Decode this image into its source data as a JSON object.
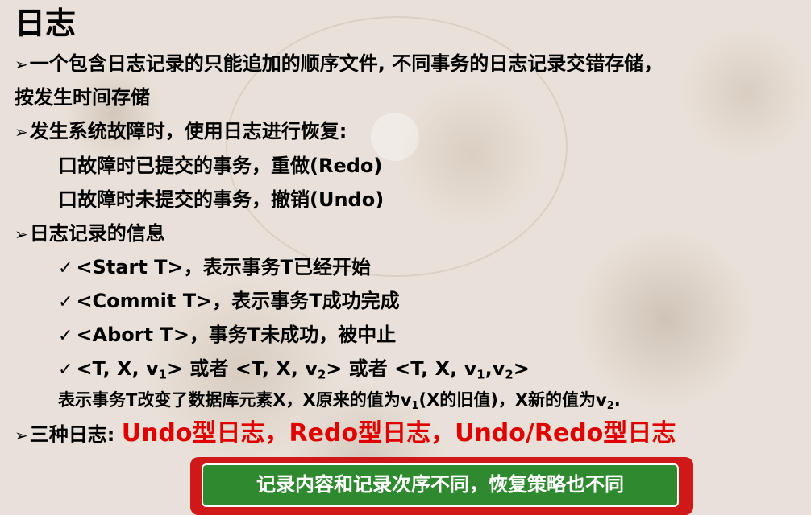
{
  "title": "日志",
  "bullet_arrow": "➢",
  "check_mark": "✓",
  "box_mark": "口",
  "point1": {
    "line1": "一个包含日志记录的只能追加的顺序文件, 不同事务的日志记录交错存储，",
    "line2": "按发生时间存储"
  },
  "point2": {
    "text": "发生系统故障时，使用日志进行恢复:",
    "sub1": "故障时已提交的事务，重做(Redo)",
    "sub2": "故障时未提交的事务，撤销(Undo)"
  },
  "point3": {
    "text": "日志记录的信息",
    "items": [
      "<Start T>，表示事务T已经开始",
      "<Commit T>，表示事务T成功完成",
      "<Abort T>，事务T未成功，被中止"
    ],
    "item4": {
      "p1": "<T, X, v",
      "s1": "1",
      "p2": "> 或者 <T, X, v",
      "s2": "2",
      "p3": "> 或者 <T, X, v",
      "s3": "1",
      "p4": ",v",
      "s4": "2",
      "p5": ">"
    },
    "desc": {
      "p1": "表示事务T改变了数据库元素X，X原来的值为v",
      "s1": "1",
      "p2": "(X的旧值)，X新的值为v",
      "s2": "2",
      "p3": "."
    }
  },
  "point4": {
    "label": "三种日志: ",
    "types": [
      "Undo型日志",
      "Redo型日志",
      "Undo/Redo型日志"
    ],
    "separator": "，"
  },
  "banner": "记录内容和记录次序不同，恢复策略也不同",
  "colors": {
    "accent_red": "#e00000",
    "banner_green": "#2f8a2f",
    "banner_border": "#d01818"
  }
}
